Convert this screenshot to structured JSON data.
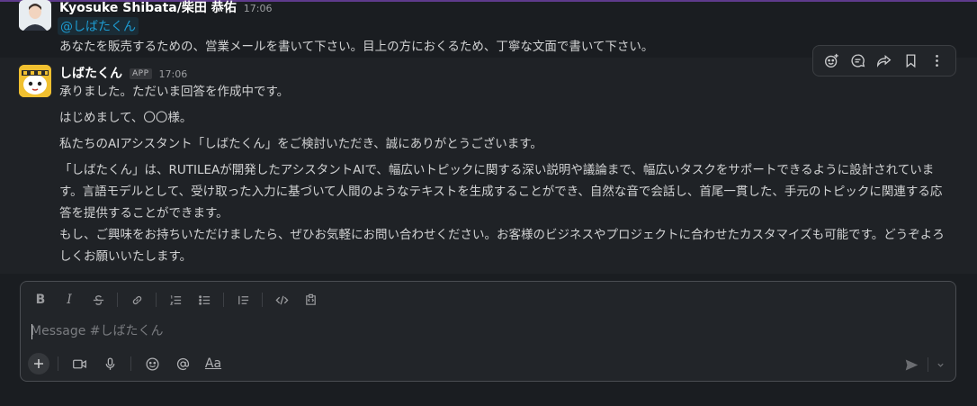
{
  "messages": [
    {
      "sender": "Kyosuke Shibata/柴田 恭佑",
      "time": "17:06",
      "mention": "@しばたくん",
      "text": "あなたを販売するための、営業メールを書いて下さい。目上の方におくるため、丁寧な文面で書いて下さい。"
    },
    {
      "sender": "しばたくん",
      "badge": "APP",
      "time": "17:06",
      "paragraphs": [
        "承りました。ただいま回答を作成中です。",
        "はじめまして、〇〇様。",
        "私たちのAIアシスタント「しばたくん」をご検討いただき、誠にありがとうございます。",
        "「しばたくん」は、RUTILEAが開発したアシスタントAIで、幅広いトピックに関する深い説明や議論まで、幅広いタスクをサポートできるように設計されています。言語モデルとして、受け取った入力に基づいて人間のようなテキストを生成することができ、自然な音で会話し、首尾一貫した、手元のトピックに関連する応答を提供することができます。",
        "もし、ご興味をお持ちいただけましたら、ぜひお気軽にお問い合わせください。お客様のビジネスやプロジェクトに合わせたカスタマイズも可能です。どうぞよろしくお願いいたします。"
      ]
    }
  ],
  "hover_toolbar": {
    "icons": [
      "add-reaction-icon",
      "reply-in-thread-icon",
      "share-icon",
      "bookmark-icon",
      "more-actions-icon"
    ]
  },
  "composer": {
    "placeholder": "Message #しばたくん",
    "value": "",
    "formatting": [
      "bold",
      "italic",
      "strikethrough",
      "link",
      "ordered-list",
      "bulleted-list",
      "blockquote",
      "code",
      "code-block"
    ],
    "bold_label": "B",
    "italic_label": "I",
    "text_format_label": "Aa"
  },
  "colors": {
    "background": "#1a1d21",
    "mention": "#1d9bd1",
    "frame_accent": "#5e3a8c"
  }
}
